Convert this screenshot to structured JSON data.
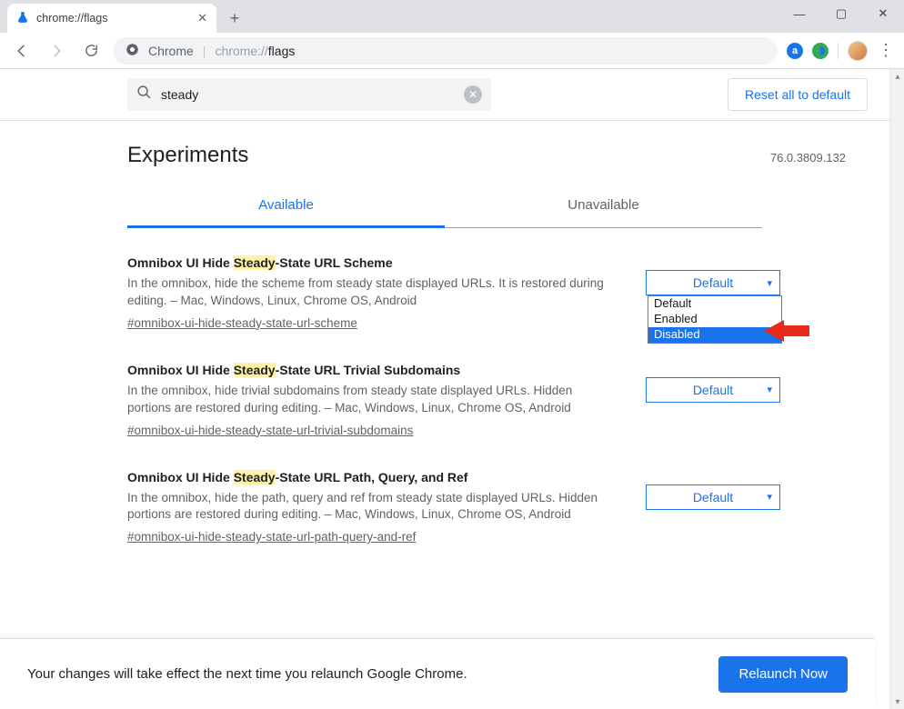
{
  "window": {
    "tab_title": "chrome://flags",
    "minimize": "—",
    "maximize": "▢",
    "close": "✕"
  },
  "toolbar": {
    "security_label": "Chrome",
    "url_faint": "chrome://",
    "url_strong": "flags",
    "ext1_letter": "a",
    "ext1_bg": "#1a73e8",
    "ext2_bg": "#34a853"
  },
  "search": {
    "value": "steady",
    "reset_label": "Reset all to default"
  },
  "page": {
    "title": "Experiments",
    "version": "76.0.3809.132"
  },
  "tabs": {
    "available": "Available",
    "unavailable": "Unavailable"
  },
  "flags": [
    {
      "title_pre": "Omnibox UI Hide ",
      "title_hl": "Steady",
      "title_post": "-State URL Scheme",
      "desc": "In the omnibox, hide the scheme from steady state displayed URLs. It is restored during editing. – Mac, Windows, Linux, Chrome OS, Android",
      "anchor": "#omnibox-ui-hide-steady-state-url-scheme",
      "value": "Default"
    },
    {
      "title_pre": "Omnibox UI Hide ",
      "title_hl": "Steady",
      "title_post": "-State URL Trivial Subdomains",
      "desc": "In the omnibox, hide trivial subdomains from steady state displayed URLs. Hidden portions are restored during editing. – Mac, Windows, Linux, Chrome OS, Android",
      "anchor": "#omnibox-ui-hide-steady-state-url-trivial-subdomains",
      "value": "Default"
    },
    {
      "title_pre": "Omnibox UI Hide ",
      "title_hl": "Steady",
      "title_post": "-State URL Path, Query, and Ref",
      "desc": "In the omnibox, hide the path, query and ref from steady state displayed URLs. Hidden portions are restored during editing. – Mac, Windows, Linux, Chrome OS, Android",
      "anchor": "#omnibox-ui-hide-steady-state-url-path-query-and-ref",
      "value": "Default"
    }
  ],
  "dropdown": {
    "options": [
      "Default",
      "Enabled",
      "Disabled"
    ],
    "highlighted": "Disabled"
  },
  "relaunch": {
    "text": "Your changes will take effect the next time you relaunch Google Chrome.",
    "button": "Relaunch Now"
  }
}
